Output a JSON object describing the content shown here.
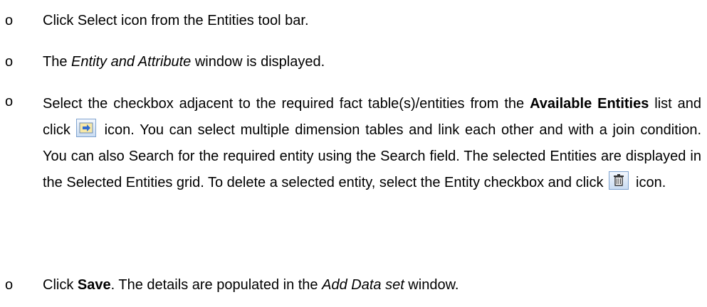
{
  "bullet_char": "o",
  "steps": [
    {
      "text": "Click Select icon from the Entities tool bar."
    },
    {
      "pre": "The ",
      "em": "Entity and Attribute",
      "post": " window is displayed."
    },
    {
      "pre": "Select the checkbox adjacent to the required fact table(s)/entities from the ",
      "strong": "Available Entities",
      "mid": " list and click",
      "icon1": "move-right-icon",
      "post1": " icon. You can select multiple dimension tables and link each other and with a join condition. You can also Search for the required entity using the Search field. The selected Entities are displayed in the Selected Entities grid. To delete a selected entity, select the Entity checkbox and click",
      "icon2": "delete-icon",
      "post2": " icon."
    },
    {
      "pre": "Click ",
      "strong": "Save",
      "mid": ". The details are populated in the ",
      "em": "Add Data set",
      "post": " window."
    }
  ]
}
